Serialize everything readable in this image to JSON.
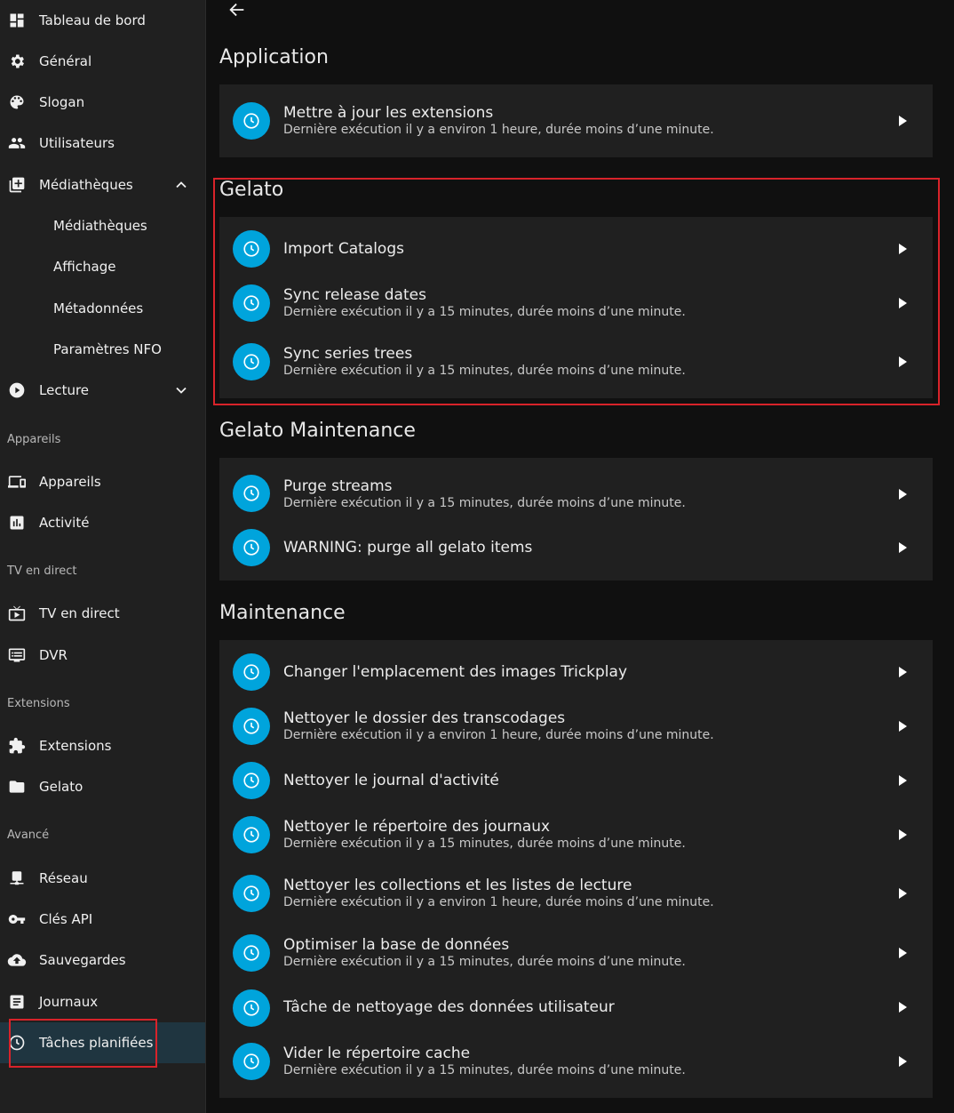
{
  "sidebar": {
    "items": [
      {
        "label": "Tableau de bord",
        "icon": "dashboard-icon"
      },
      {
        "label": "Général",
        "icon": "gear-icon"
      },
      {
        "label": "Slogan",
        "icon": "palette-icon"
      },
      {
        "label": "Utilisateurs",
        "icon": "people-icon"
      },
      {
        "label": "Médiathèques",
        "icon": "library-add-icon"
      },
      {
        "label": "Médiathèques"
      },
      {
        "label": "Affichage"
      },
      {
        "label": "Métadonnées"
      },
      {
        "label": "Paramètres NFO"
      },
      {
        "label": "Lecture",
        "icon": "play-circle-icon"
      },
      {
        "label": "Appareils",
        "icon": "devices-icon"
      },
      {
        "label": "Activité",
        "icon": "analytics-icon"
      },
      {
        "label": "TV en direct",
        "icon": "live-tv-icon"
      },
      {
        "label": "DVR",
        "icon": "dvr-icon"
      },
      {
        "label": "Extensions",
        "icon": "puzzle-icon"
      },
      {
        "label": "Gelato",
        "icon": "folder-icon"
      },
      {
        "label": "Réseau",
        "icon": "network-icon"
      },
      {
        "label": "Clés API",
        "icon": "key-icon"
      },
      {
        "label": "Sauvegardes",
        "icon": "cloud-upload-icon"
      },
      {
        "label": "Journaux",
        "icon": "article-icon"
      },
      {
        "label": "Tâches planifiées",
        "icon": "clock-icon"
      }
    ],
    "sections": [
      "Appareils",
      "TV en direct",
      "Extensions",
      "Avancé"
    ]
  },
  "groups": [
    {
      "title": "Application",
      "tasks": [
        {
          "name": "Mettre à jour les extensions",
          "status": "Dernière exécution il y a environ 1 heure, durée moins d’une minute."
        }
      ]
    },
    {
      "title": "Gelato",
      "tasks": [
        {
          "name": "Import Catalogs",
          "status": ""
        },
        {
          "name": "Sync release dates",
          "status": "Dernière exécution il y a 15 minutes, durée moins d’une minute."
        },
        {
          "name": "Sync series trees",
          "status": "Dernière exécution il y a 15 minutes, durée moins d’une minute."
        }
      ]
    },
    {
      "title": "Gelato Maintenance",
      "tasks": [
        {
          "name": "Purge streams",
          "status": "Dernière exécution il y a 15 minutes, durée moins d’une minute."
        },
        {
          "name": "WARNING: purge all gelato items",
          "status": ""
        }
      ]
    },
    {
      "title": "Maintenance",
      "tasks": [
        {
          "name": "Changer l'emplacement des images Trickplay",
          "status": ""
        },
        {
          "name": "Nettoyer le dossier des transcodages",
          "status": "Dernière exécution il y a environ 1 heure, durée moins d’une minute."
        },
        {
          "name": "Nettoyer le journal d'activité",
          "status": ""
        },
        {
          "name": "Nettoyer le répertoire des journaux",
          "status": "Dernière exécution il y a 15 minutes, durée moins d’une minute."
        },
        {
          "name": "Nettoyer les collections et les listes de lecture",
          "status": "Dernière exécution il y a environ 1 heure, durée moins d’une minute."
        },
        {
          "name": "Optimiser la base de données",
          "status": "Dernière exécution il y a 15 minutes, durée moins d’une minute."
        },
        {
          "name": "Tâche de nettoyage des données utilisateur",
          "status": ""
        },
        {
          "name": "Vider le répertoire cache",
          "status": "Dernière exécution il y a 15 minutes, durée moins d’une minute."
        }
      ]
    }
  ],
  "colors": {
    "accent": "#00a4dc",
    "highlight_border": "#d8232a",
    "card": "#202020",
    "active_nav": "#1f3540"
  }
}
